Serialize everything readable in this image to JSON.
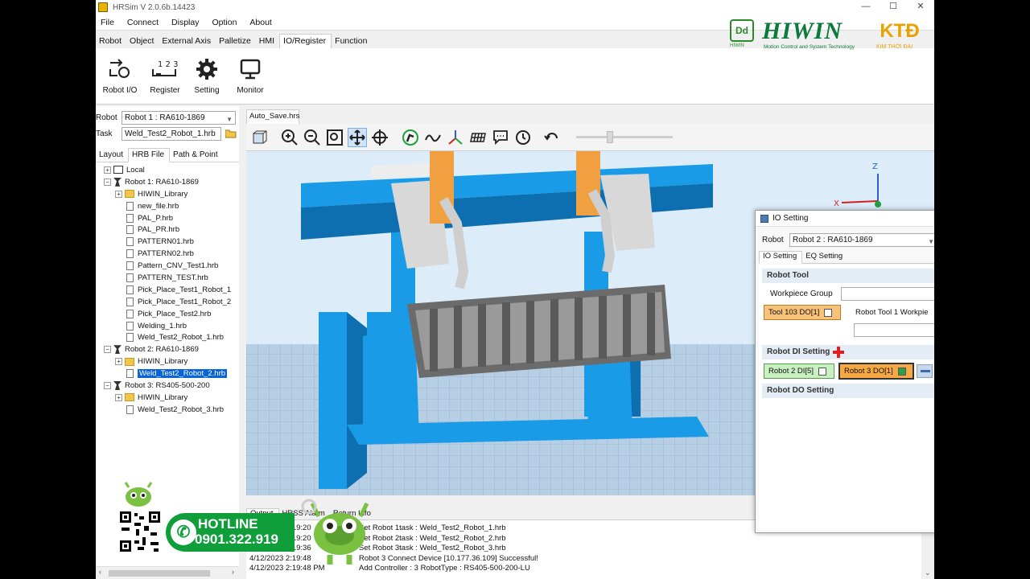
{
  "window": {
    "title": "HRSim V 2.0.6b.14423",
    "controls": [
      "—",
      "☐",
      "✕"
    ]
  },
  "menu": [
    "File",
    "Connect",
    "Display",
    "Option",
    "About"
  ],
  "ribbon_tabs": [
    "Robot",
    "Object",
    "External Axis",
    "Palletize",
    "HMI",
    "IO/Register",
    "Function"
  ],
  "ribbon_active_tab": "IO/Register",
  "ribbon_buttons": [
    {
      "label": "Robot I/O",
      "icon": "robot-io-icon"
    },
    {
      "label": "Register",
      "icon": "register-icon"
    },
    {
      "label": "Setting",
      "icon": "gear-icon"
    },
    {
      "label": "Monitor",
      "icon": "monitor-icon"
    }
  ],
  "logos": {
    "dd": "Dd",
    "dd_sub": "HIWIN",
    "hiwin": "HIWIN",
    "hiwin_sub": "Motion Control and System Technology",
    "ktd": "KTĐ",
    "ktd_sub": "KIM THỜI ĐẠI"
  },
  "left": {
    "robot_label": "Robot",
    "robot_value": "Robot 1 : RA610-1869",
    "task_label": "Task",
    "task_value": "Weld_Test2_Robot_1.hrb",
    "tabs": [
      "Layout",
      "HRB File",
      "Path & Point"
    ],
    "active_tab": "HRB File",
    "tree": [
      {
        "label": "Local",
        "level": 0,
        "icon": "pc",
        "exp": "+"
      },
      {
        "label": "Robot 1: RA610-1869",
        "level": 0,
        "icon": "robot",
        "exp": "−"
      },
      {
        "label": "HIWIN_Library",
        "level": 1,
        "icon": "folder",
        "exp": "+"
      },
      {
        "label": "new_file.hrb",
        "level": 1,
        "icon": "file"
      },
      {
        "label": "PAL_P.hrb",
        "level": 1,
        "icon": "file"
      },
      {
        "label": "PAL_PR.hrb",
        "level": 1,
        "icon": "file"
      },
      {
        "label": "PATTERN01.hrb",
        "level": 1,
        "icon": "file"
      },
      {
        "label": "PATTERN02.hrb",
        "level": 1,
        "icon": "file"
      },
      {
        "label": "Pattern_CNV_Test1.hrb",
        "level": 1,
        "icon": "file"
      },
      {
        "label": "PATTERN_TEST.hrb",
        "level": 1,
        "icon": "file"
      },
      {
        "label": "Pick_Place_Test1_Robot_1",
        "level": 1,
        "icon": "file"
      },
      {
        "label": "Pick_Place_Test1_Robot_2",
        "level": 1,
        "icon": "file"
      },
      {
        "label": "Pick_Place_Test2.hrb",
        "level": 1,
        "icon": "file"
      },
      {
        "label": "Welding_1.hrb",
        "level": 1,
        "icon": "file"
      },
      {
        "label": "Weld_Test2_Robot_1.hrb",
        "level": 1,
        "icon": "file"
      },
      {
        "label": "Robot 2: RA610-1869",
        "level": 0,
        "icon": "robot",
        "exp": "−"
      },
      {
        "label": "HIWIN_Library",
        "level": 1,
        "icon": "folder",
        "exp": "+"
      },
      {
        "label": "Weld_Test2_Robot_2.hrb",
        "level": 1,
        "icon": "file",
        "selected": true
      },
      {
        "label": "Robot 3: RS405-500-200",
        "level": 0,
        "icon": "robot",
        "exp": "−"
      },
      {
        "label": "HIWIN_Library",
        "level": 1,
        "icon": "folder",
        "exp": "+"
      },
      {
        "label": "Weld_Test2_Robot_3.hrb",
        "level": 1,
        "icon": "file"
      }
    ]
  },
  "doc_tab": "Auto_Save.hrs",
  "viewport_axes": {
    "z": "Z",
    "x": "X"
  },
  "output": {
    "tabs": [
      "Output",
      "HRSS Alarm",
      "Return Info"
    ],
    "lines": [
      {
        "time": "4/12/2023 2:19:20",
        "msg": "Set Robot 1task : Weld_Test2_Robot_1.hrb"
      },
      {
        "time": "4/12/2023 2:19:20",
        "msg": "Set Robot 2task : Weld_Test2_Robot_2.hrb"
      },
      {
        "time": "4/12/2023 2:19:36",
        "msg": "Set Robot 3task : Weld_Test2_Robot_3.hrb"
      },
      {
        "time": "4/12/2023 2:19:48",
        "msg": "Robot 3 Connect Device [10.177.36.109] Successful!"
      },
      {
        "time": "4/12/2023 2:19:48 PM",
        "msg": "Add Controller : 3 RobotType : RS405-500-200-LU"
      }
    ]
  },
  "io_dialog": {
    "title": "IO Setting",
    "robot_label": "Robot",
    "robot_value": "Robot 2 : RA610-1869",
    "tabs": [
      "IO Setting",
      "EQ Setting"
    ],
    "active_tab": "IO Setting",
    "robot_tool_header": "Robot Tool",
    "workpiece_group_label": "Workpiece Group",
    "tool_chip": "Tool 103 DO[1]",
    "robot_tool_1_label": "Robot Tool 1 Workpie",
    "di_header": "Robot DI Setting",
    "di_chip_1": "Robot 2 DI[5]",
    "di_chip_2": "Robot 3 DO[1]",
    "do_header": "Robot DO Setting"
  },
  "promo": {
    "hotline_label": "HOTLINE",
    "hotline_number": "0901.322.919"
  },
  "colors": {
    "hiwin_green": "#0b7a3c",
    "ktd_orange": "#e8a100",
    "viewport_bg": "#dcecf8",
    "fixture_blue": "#1a9be8",
    "robot_orange": "#f0a040"
  }
}
